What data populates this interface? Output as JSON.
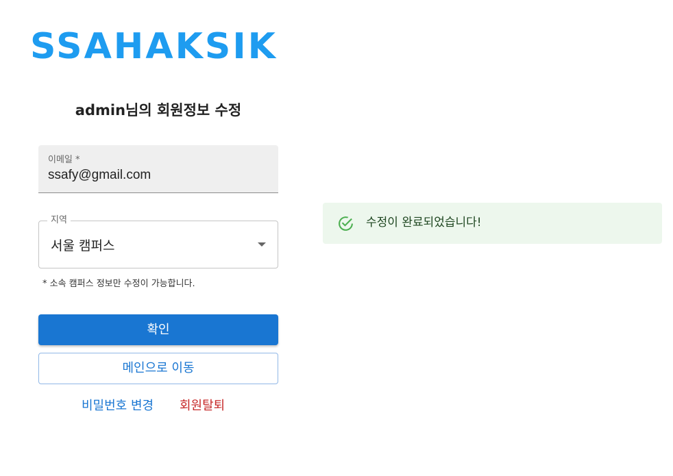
{
  "brand": {
    "logo_text": "SSAHAKSIK"
  },
  "page": {
    "title": "admin님의 회원정보 수정"
  },
  "form": {
    "email": {
      "label": "이메일 *",
      "value": "ssafy@gmail.com"
    },
    "region": {
      "label": "지역",
      "value": "서울 캠퍼스"
    },
    "helper_text": "* 소속 캠퍼스 정보만 수정이 가능합니다.",
    "confirm_label": "확인",
    "main_label": "메인으로 이동"
  },
  "links": {
    "change_password": "비밀번호 변경",
    "withdraw": "회원탈퇴"
  },
  "alert": {
    "message": "수정이 완료되었습니다!",
    "icon": "check-circle-icon",
    "color": "#4caf50"
  },
  "colors": {
    "brand": "#1e9cf0",
    "primary": "#1976d2",
    "danger": "#c62828",
    "success_bg": "#edf7ed"
  }
}
